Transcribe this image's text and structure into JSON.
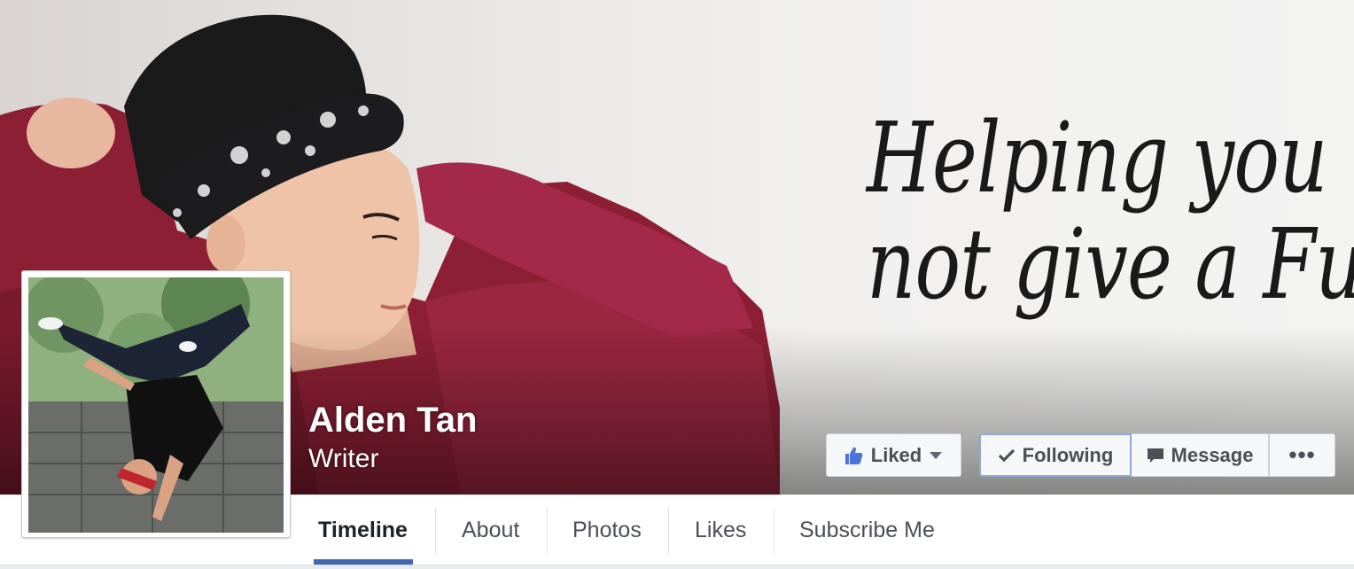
{
  "cover": {
    "text_line1": "Helping you",
    "text_line2": "not give a Fuck"
  },
  "page": {
    "name": "Alden Tan",
    "category": "Writer"
  },
  "actions": {
    "liked_label": "Liked",
    "following_label": "Following",
    "message_label": "Message",
    "more_label": "•••"
  },
  "nav": {
    "tabs": [
      {
        "label": "Timeline",
        "active": true
      },
      {
        "label": "About"
      },
      {
        "label": "Photos"
      },
      {
        "label": "Likes"
      },
      {
        "label": "Subscribe Me"
      }
    ]
  },
  "colors": {
    "accent": "#4267b2",
    "like_blue": "#4a76d9",
    "cover_shirt": "#8d1f35"
  },
  "icons": [
    "thumbs-up-icon",
    "caret-down-icon",
    "check-icon",
    "message-icon",
    "more-icon"
  ]
}
